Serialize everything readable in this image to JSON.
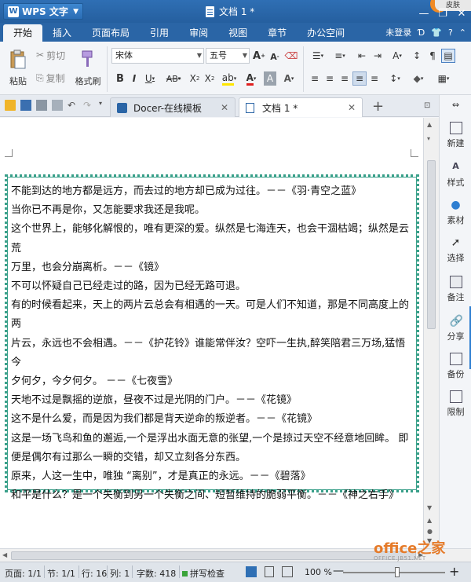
{
  "app": {
    "name": "WPS 文字",
    "doc_title": "文档 1 *",
    "skin_label": "皮肤"
  },
  "menu": {
    "tabs": [
      "开始",
      "插入",
      "页面布局",
      "引用",
      "审阅",
      "视图",
      "章节",
      "办公空间"
    ],
    "login": "未登录"
  },
  "ribbon": {
    "paste": "粘贴",
    "cut": "剪切",
    "copy": "复制",
    "format_painter": "格式刷",
    "font_name": "宋体",
    "font_size": "五号"
  },
  "doc_tabs": [
    {
      "label": "Docer-在线模板"
    },
    {
      "label": "文档 1 *"
    }
  ],
  "document": {
    "lines": [
      "不能到达的地方都是远方，而去过的地方却已成为过往。－－《羽·青空之蓝》",
      "当你已不再是你，又怎能要求我还是我呢。",
      "这个世界上，能够化解恨的，唯有更深的爱。纵然是七海连天，也会干涸枯竭；纵然是云荒",
      "万里，也会分崩离析。－－《镜》",
      "不可以怀疑自己已经走过的路，因为已经无路可退。",
      "有的时候看起来，天上的两片云总会有相遇的一天。可是人们不知道，那是不同高度上的两",
      "片云，永远也不会相遇。－－《护花铃》谁能常伴汝？空吓一生执,醉笑陪君三万场,猛悟今",
      "夕何夕，今夕何夕。 －－《七夜雪》",
      "天地不过是飘摇的逆旅，昼夜不过是光阴的门户。－－《花镜》",
      "这不是什么爱，而是因为我们都是背天逆命的叛逆者。－－《花镜》",
      "这是一场飞鸟和鱼的邂逅,一个是浮出水面无意的张望,一个是掠过天空不经意地回眸。 即",
      "便是偶尔有过那么一瞬的交错，却又立刻各分东西。",
      "原来，人这一生中，唯独 “离别”，才是真正的永远。－－《碧落》",
      "和平是什么？是一个失衡到另一个失衡之间、短暂维持的脆弱平衡。－－《神之右手》"
    ]
  },
  "side_panel": [
    "新建",
    "样式",
    "素材",
    "选择",
    "备注",
    "分享",
    "备份",
    "限制"
  ],
  "status": {
    "page": "页面: 1/1",
    "section": "节: 1/1",
    "row": "行: 16",
    "col": "列: 1",
    "words": "字数: 418",
    "spell": "拼写检查",
    "zoom": "100 %"
  },
  "watermark": {
    "main": "office之家",
    "sub": "OFFICE.JB51.NET"
  },
  "colors": {
    "title_bar": "#2f6fb4",
    "page_border": "#3aa08a",
    "accent": "#2f7fd1"
  }
}
